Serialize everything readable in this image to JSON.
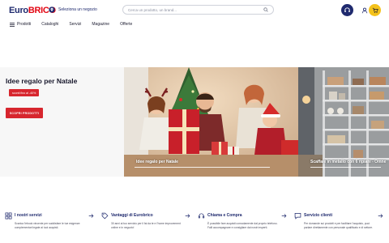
{
  "header": {
    "logo_euro": "Euro",
    "logo_brico": "BRICO",
    "store_label": "Seleziona un negozio",
    "search_placeholder": "Cerca un prodotto, un brand...",
    "icons": [
      "map-pin-icon",
      "search-icon",
      "headset-icon",
      "user-icon",
      "cart-icon"
    ]
  },
  "nav": {
    "items": [
      {
        "label": "Prodotti",
        "icon": "menu-icon"
      },
      {
        "label": "Cataloghi"
      },
      {
        "label": "Servizi"
      },
      {
        "label": "Magazine"
      },
      {
        "label": "Offerte"
      }
    ]
  },
  "hero": {
    "title": "Idee regalo per Natale",
    "badge": "sconti fino al -40%",
    "cta": "SCOPRI PRODOTTI",
    "slides": [
      {
        "caption": "Idee regalo per Natale"
      },
      {
        "caption": "Scaffale in metallo con 6 ripiani - Omne"
      }
    ]
  },
  "services": [
    {
      "title": "I nostri servizi",
      "icon": "grid-icon",
      "description": "Scarica l'ebook vincente per soddisfare le tue esigenze: complementari legate ai tuoi acquisti."
    },
    {
      "title": "Vantaggi di Eurobrico",
      "icon": "tag-icon",
      "description": "30 anni al tuo servizio per il fai da te e l'home improvement online e in negozio!"
    },
    {
      "title": "Chiama e Compra",
      "icon": "headset-icon",
      "description": "È possibile fare acquisti comodamente dal proprio telefono. Falli accompagnare e consigliare dai nostri esperti."
    },
    {
      "title": "Servizio clienti",
      "icon": "chat-icon",
      "description": "Per domande sui prodotti e per facilitare l'acquisto, puoi parlare direttamente con personale qualificato e di settore."
    }
  ],
  "colors": {
    "brand_navy": "#1f2a6e",
    "brand_red": "#e30613",
    "cta_red": "#d7262e",
    "cart_yellow": "#f4c21b"
  }
}
